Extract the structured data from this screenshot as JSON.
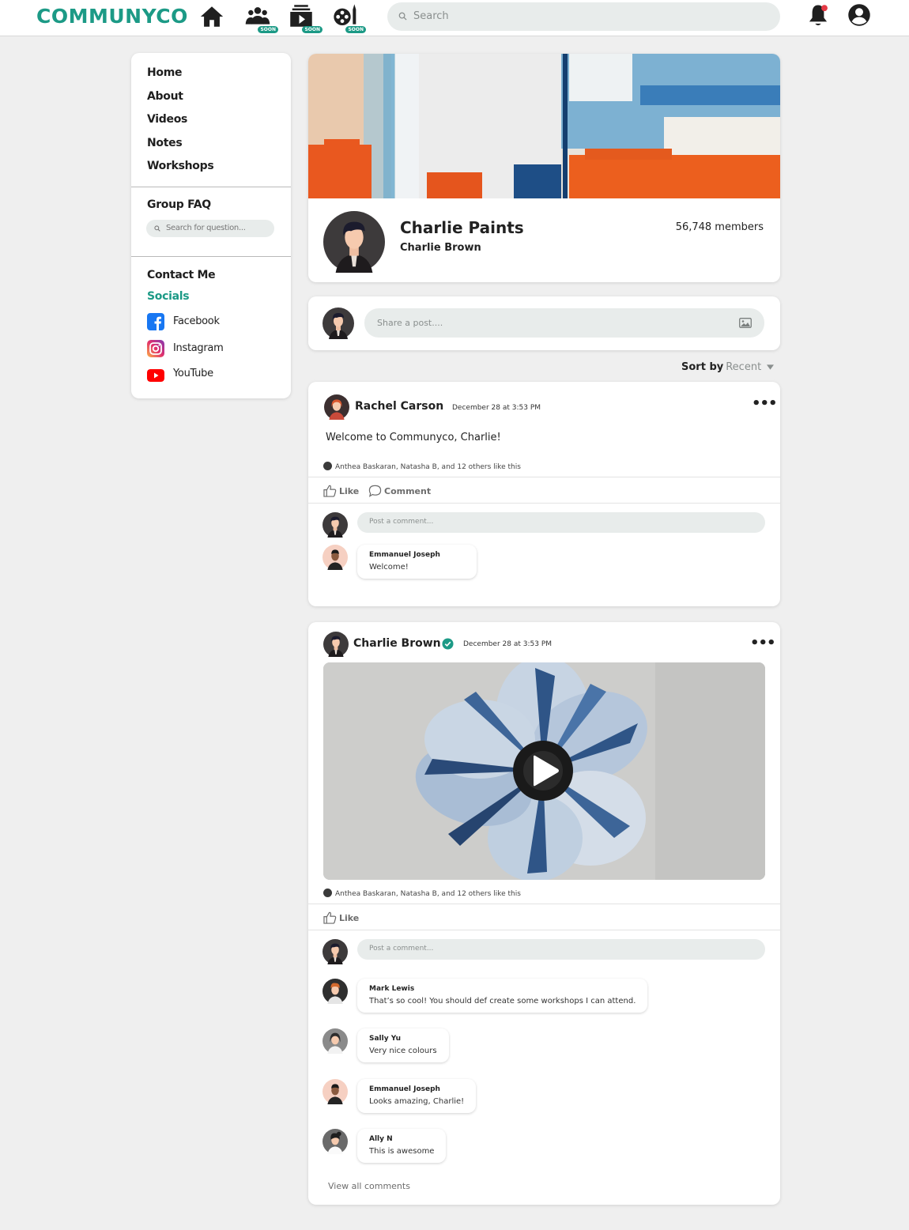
{
  "header": {
    "logo": "COMMUNYCO",
    "soon_badge": "SOON",
    "search_placeholder": "Search",
    "icons": [
      "home-icon",
      "groups-icon",
      "video-icon",
      "workshop-icon",
      "bell-icon",
      "account-icon"
    ],
    "notification_dot_color": "#e53945"
  },
  "sidebar": {
    "links": [
      "Home",
      "About",
      "Videos",
      "Notes",
      "Workshops"
    ],
    "faq_title": "Group FAQ",
    "faq_search_placeholder": "Search for question...",
    "contact": "Contact Me",
    "socials_title": "Socials",
    "socials": [
      {
        "label": "Facebook",
        "icon": "facebook-icon",
        "color": "#1877f2"
      },
      {
        "label": "Instagram",
        "icon": "instagram-icon",
        "color": "#e1306c"
      },
      {
        "label": "YouTube",
        "icon": "youtube-icon",
        "color": "#ff0000"
      }
    ]
  },
  "group": {
    "name": "Charlie Paints",
    "owner": "Charlie Brown",
    "members": "56,748 members"
  },
  "share": {
    "placeholder": "Share a post....",
    "icon": "image-icon"
  },
  "sort": {
    "label": "Sort by",
    "value": "Recent"
  },
  "posts": [
    {
      "author": "Rachel Carson",
      "time": "December 28 at 3:53 PM",
      "text": "Welcome to Communyco, Charlie!",
      "likes": "Anthea Baskaran, Natasha B, and 12 others like this",
      "like_label": "Like",
      "comment_label": "Comment",
      "comment_placeholder": "Post a comment...",
      "comments": [
        {
          "name": "Emmanuel Joseph",
          "text": "Welcome!"
        }
      ]
    },
    {
      "author": "Charlie Brown",
      "verified": true,
      "time": "December 28 at 3:53 PM",
      "likes": "Anthea Baskaran, Natasha B, and 12 others like this",
      "like_label": "Like",
      "comment_placeholder": "Post a comment...",
      "comments": [
        {
          "name": "Mark Lewis",
          "text": "That’s so cool! You should def create some workshops I can attend."
        },
        {
          "name": "Sally Yu",
          "text": "Very nice colours"
        },
        {
          "name": "Emmanuel Joseph",
          "text": "Looks amazing, Charlie!"
        },
        {
          "name": "Ally N",
          "text": "This is awesome"
        }
      ],
      "view_all": "View all comments"
    }
  ],
  "colors": {
    "brand": "#1c9a86",
    "background": "#efefef"
  }
}
